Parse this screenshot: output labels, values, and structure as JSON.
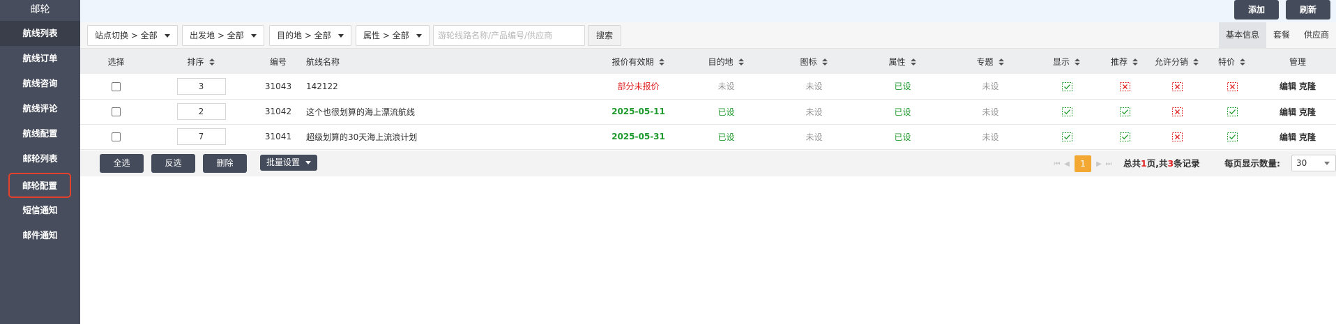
{
  "sidebar": {
    "title": "邮轮",
    "items": [
      {
        "label": "航线列表"
      },
      {
        "label": "航线订单"
      },
      {
        "label": "航线咨询"
      },
      {
        "label": "航线评论"
      },
      {
        "label": "航线配置"
      },
      {
        "label": "邮轮列表"
      },
      {
        "label": "邮轮配置"
      },
      {
        "label": "短信通知"
      },
      {
        "label": "邮件通知"
      }
    ]
  },
  "topbar": {
    "add_label": "添加",
    "refresh_label": "刷新"
  },
  "filters": {
    "site": "站点切换 > 全部",
    "origin": "出发地 > 全部",
    "destination": "目的地 > 全部",
    "attribute": "属性 > 全部",
    "search_placeholder": "游轮线路名称/产品编号/供应商",
    "search_label": "搜索"
  },
  "tabs": [
    "基本信息",
    "套餐",
    "供应商"
  ],
  "table": {
    "headers": {
      "select": "选择",
      "order": "排序",
      "id": "编号",
      "name": "航线名称",
      "quote_valid": "报价有效期",
      "destination": "目的地",
      "icon": "图标",
      "attribute": "属性",
      "topic": "专题",
      "display": "显示",
      "recommend": "推荐",
      "distribution": "允许分销",
      "special": "特价",
      "manage": "管理"
    },
    "rows": [
      {
        "order": "3",
        "id": "31043",
        "name": "142122",
        "quote_valid": "部分未报价",
        "destination": "未设",
        "icon": "未设",
        "attribute": "已设",
        "topic": "未设",
        "display": true,
        "recommend": false,
        "distribution": false,
        "special": false,
        "edit": "编辑",
        "clone": "克隆"
      },
      {
        "order": "2",
        "id": "31042",
        "name": "这个也很划算的海上漂流航线",
        "quote_valid": "2025-05-11",
        "destination": "已设",
        "icon": "未设",
        "attribute": "已设",
        "topic": "未设",
        "display": true,
        "recommend": true,
        "distribution": false,
        "special": true,
        "edit": "编辑",
        "clone": "克隆"
      },
      {
        "order": "7",
        "id": "31041",
        "name": "超级划算的30天海上流浪计划",
        "quote_valid": "2025-05-31",
        "destination": "已设",
        "icon": "未设",
        "attribute": "已设",
        "topic": "未设",
        "display": true,
        "recommend": true,
        "distribution": false,
        "special": true,
        "edit": "编辑",
        "clone": "克隆"
      }
    ]
  },
  "footer": {
    "select_all": "全选",
    "invert": "反选",
    "delete": "删除",
    "batch": "批量设置",
    "current_page": "1",
    "total_prefix": "总共",
    "total_pages": "1",
    "pages_suffix": "页,共",
    "total_records": "3",
    "records_suffix": "条记录",
    "page_size_label": "每页显示数量:",
    "page_size": "30"
  },
  "colors": {
    "sidebar": "#474d5c",
    "accent_red": "#e02020",
    "accent_green": "#1e9a2c",
    "pager_active": "#f2a833"
  }
}
